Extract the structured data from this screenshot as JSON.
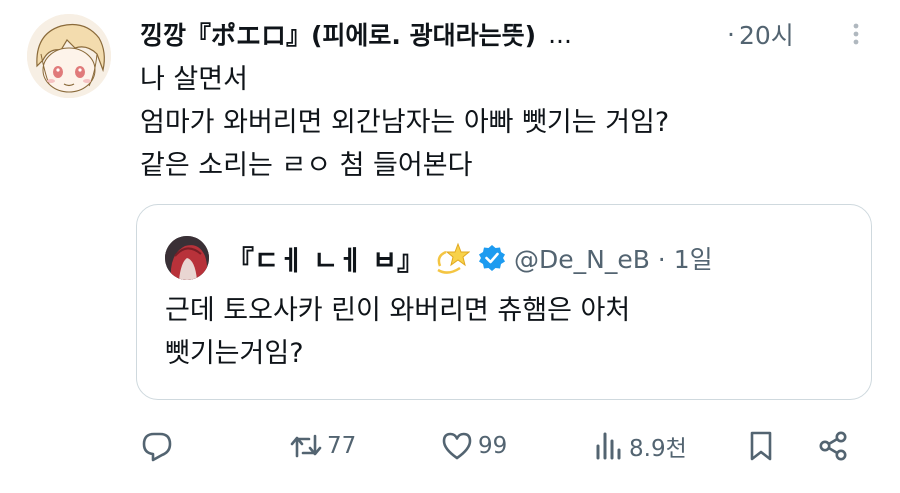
{
  "tweet": {
    "display_name": "낑깡『ポエロ』(피에로. 광대라는뜻)",
    "truncation": "...",
    "separator": "·",
    "time": "20시",
    "lines": [
      "나 살면서",
      "엄마가 와버리면 외간남자는 아빠 뺏기는 거임?",
      "같은 소리는 ㄹㅇ 첨 들어본다"
    ]
  },
  "quote": {
    "display_name": "『ㄷㅔ ㄴㅔ ㅂ』",
    "emoji": "dizzy-star",
    "verified": "verified-badge",
    "handle": "@De_N_eB · 1일",
    "lines": [
      "근데 토오사카 린이 와버리면 츄햄은 아처",
      "뺏기는거임?"
    ]
  },
  "actions": {
    "reply": {
      "icon": "reply-icon",
      "count": ""
    },
    "retweet": {
      "icon": "retweet-icon",
      "count": "77"
    },
    "like": {
      "icon": "heart-icon",
      "count": "99"
    },
    "views": {
      "icon": "views-icon",
      "count": "8.9천"
    },
    "bookmark": {
      "icon": "bookmark-icon",
      "count": ""
    },
    "share": {
      "icon": "share-icon",
      "count": ""
    }
  },
  "colors": {
    "text": "#0f1419",
    "secondary": "#536471",
    "border": "#cfd9de",
    "verified": "#1d9bf0"
  }
}
